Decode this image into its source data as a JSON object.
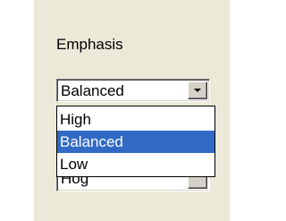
{
  "panel": {
    "label": "Emphasis",
    "background": "#ece9d8"
  },
  "combo": {
    "value": "Balanced",
    "options": [
      {
        "label": "High",
        "selected": false
      },
      {
        "label": "Balanced",
        "selected": true
      },
      {
        "label": "Low",
        "selected": false
      }
    ],
    "selection_color": "#316ac5"
  },
  "covered_field": {
    "value": "Hog"
  }
}
